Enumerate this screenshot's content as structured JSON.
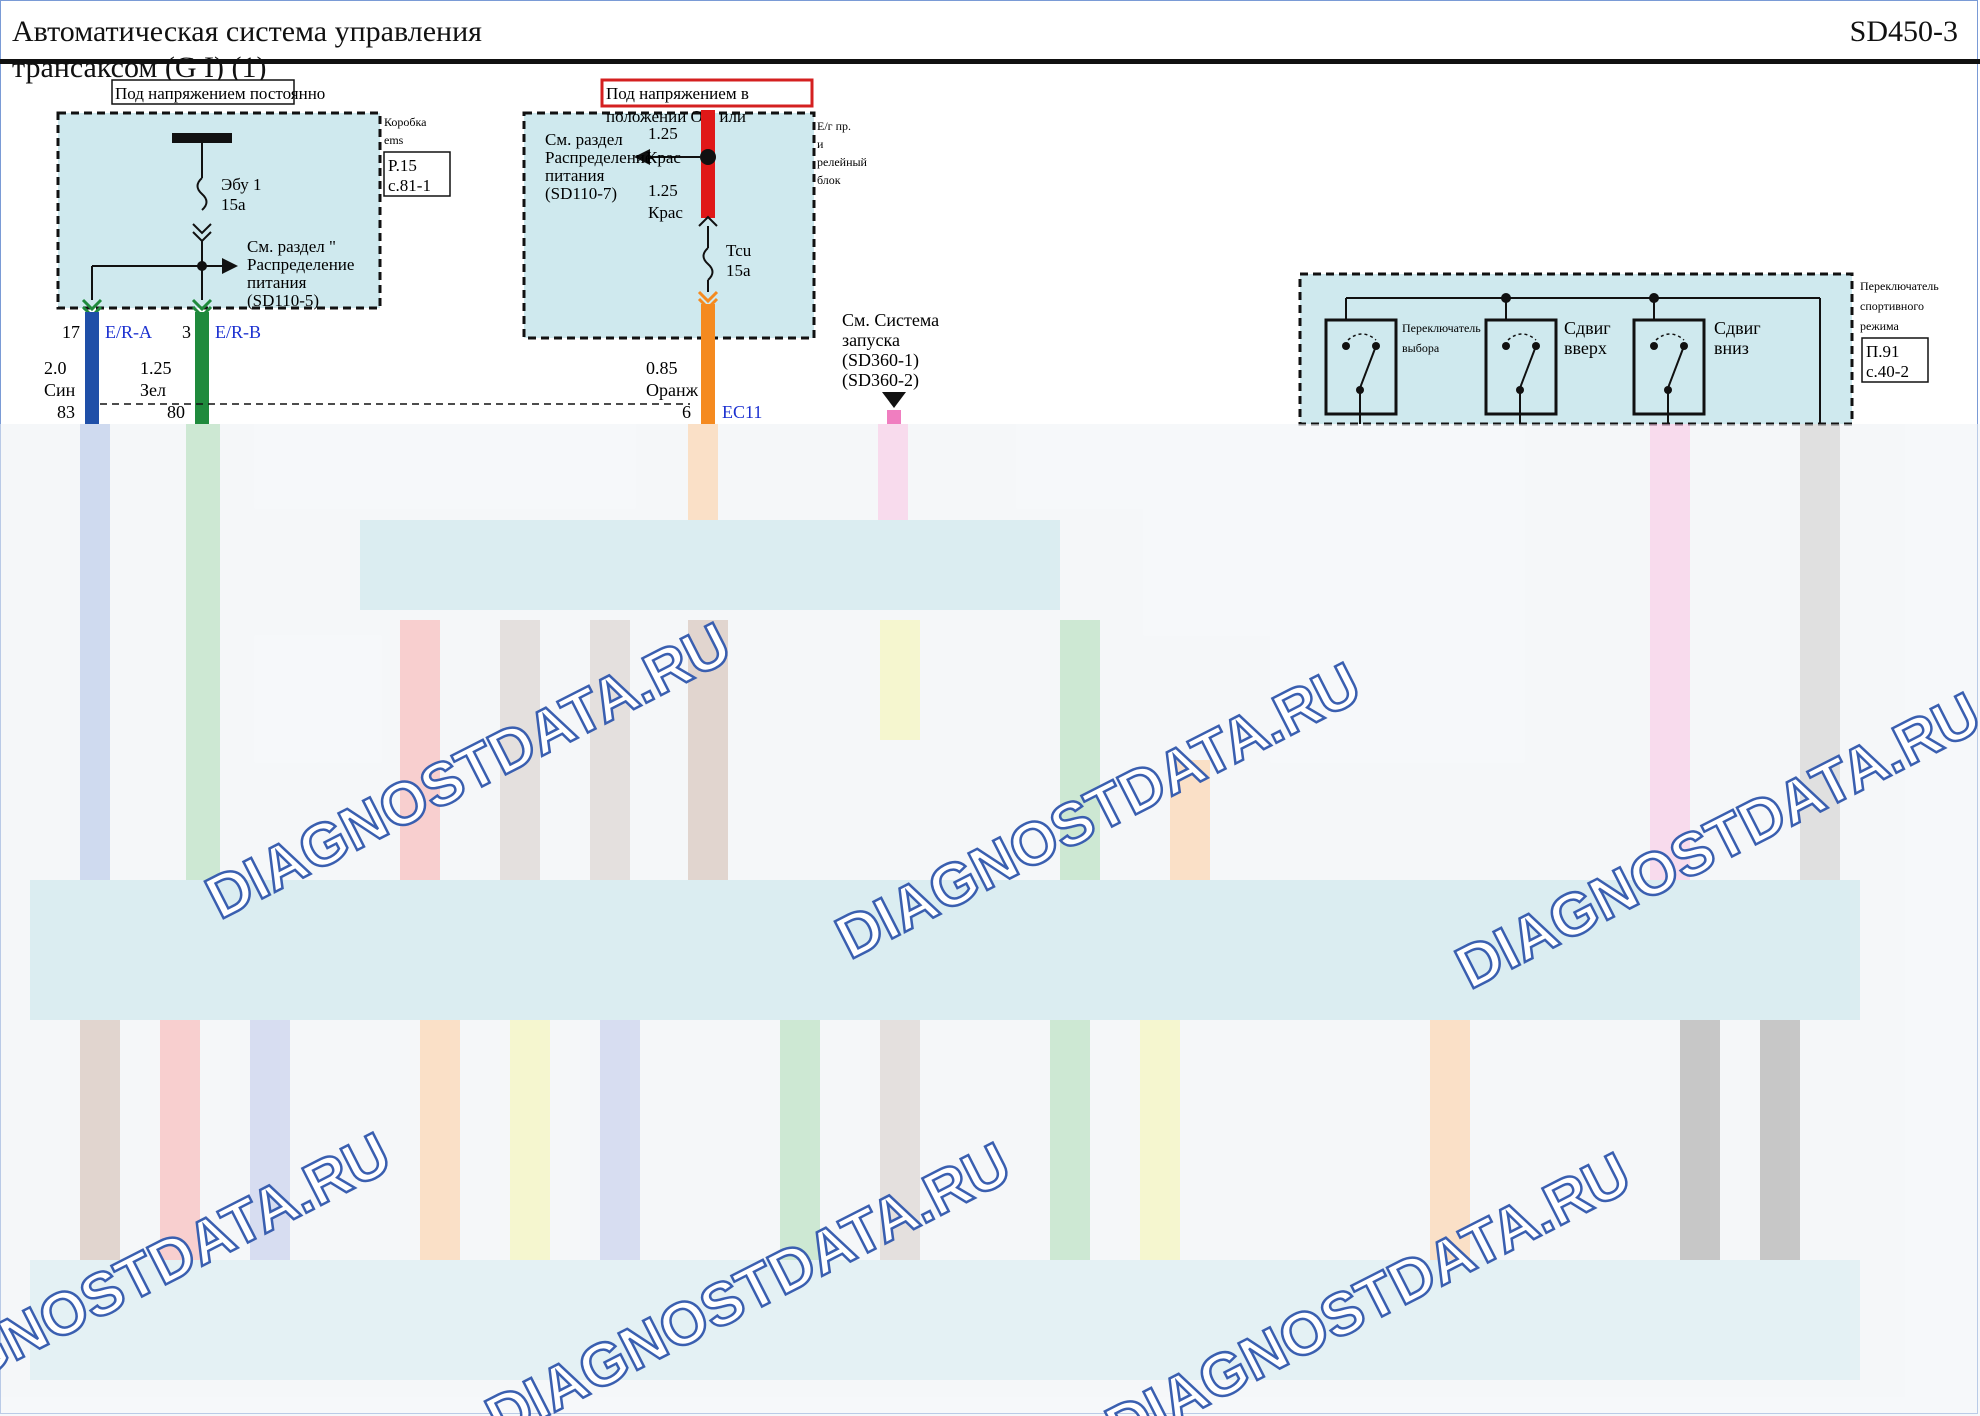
{
  "header": {
    "title": "Автоматическая система управления трансаксом (G I) (1)",
    "code": "SD450-3"
  },
  "left_block": {
    "supply_label": "Под напряжением постоянно",
    "fuse": "Эбу 1",
    "fuse_rating": "15a",
    "see_section": "См. раздел \" Распределение питания (SD110-5)",
    "box_label": "Коробка ems",
    "ref_page": "P.15",
    "ref_sheet": "с.81-1",
    "pin_a": "17",
    "pin_a_label": "E/R-A",
    "pin_b": "3",
    "pin_b_label": "E/R-B",
    "wire_a_size": "2.0",
    "wire_a_color": "Син",
    "wire_a_pin": "83",
    "wire_b_size": "1.25",
    "wire_b_color": "Зел",
    "wire_b_pin": "80"
  },
  "middle_block": {
    "supply_label": "Под напряжением в положении ON или",
    "see_section": "См. раздел Распределение питания (SD110-7)",
    "wire_top_size": "1.25",
    "wire_top_color": "Крас",
    "wire_mid_size": "1.25",
    "wire_mid_color": "Крас",
    "fuse": "Tcu",
    "fuse_rating": "15a",
    "box_label": "Е/г пр. и релейный блок",
    "wire_out_size": "0.85",
    "wire_out_color": "Оранж",
    "wire_out_pin": "6",
    "connector": "EC11"
  },
  "start_ref": {
    "label": "См. Система запуска (SD360-1) (SD360-2)"
  },
  "sport_switch": {
    "box_label": "Переключатель спортивного режима",
    "sel_label": "Переключатель выбора",
    "up_label": "Сдвиг вверх",
    "down_label": "Сдвиг вниз",
    "ref_page": "П.91",
    "ref_sheet": "с.40-2"
  },
  "watermarks": [
    "DIAGNOSTDATA.RU",
    "DIAGNOSTDATA.RU",
    "DIAGNOSTDATA.RU",
    "DIAGNOSTDATA.RU",
    "DIAGNOSTDATA.RU",
    "DIAGNOSTDATA.RU"
  ],
  "colors": {
    "module_fill": "#cfe9ee",
    "wire_blue": "#1f4fa8",
    "wire_green": "#1f8a3c",
    "wire_red": "#e01818",
    "wire_orange": "#f58a1f",
    "wire_pink": "#f07ec0",
    "label_blue": "#1a2fd0",
    "highlight_red": "#d42020"
  }
}
